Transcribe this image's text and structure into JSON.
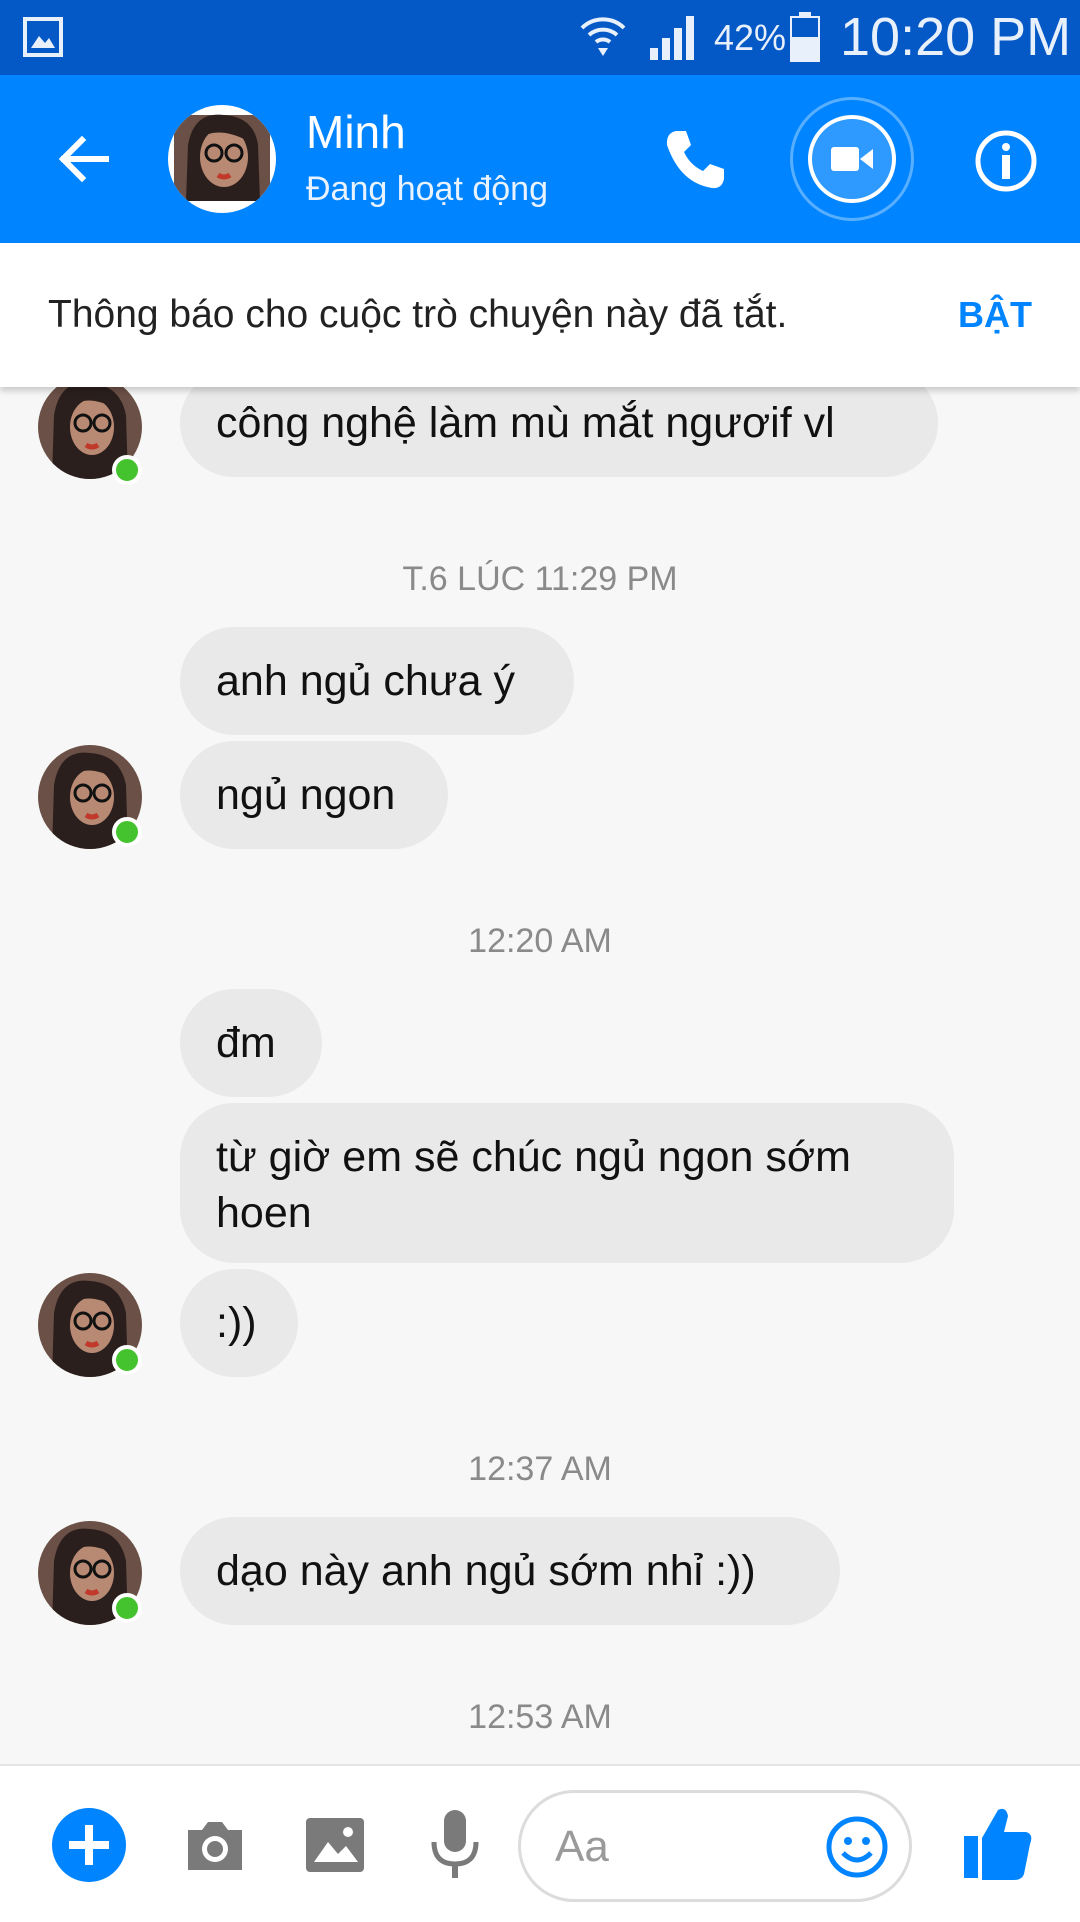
{
  "status_bar": {
    "battery_percent": "42%",
    "time": "10:20 PM"
  },
  "header": {
    "contact_name": "Minh",
    "contact_status": "Đang hoạt động"
  },
  "notice": {
    "text": "Thông báo cho cuộc trò chuyện này đã tắt.",
    "action_label": "BẬT"
  },
  "messages": [
    {
      "type": "bubble",
      "text": "công nghệ làm mù mắt ngươif vl"
    },
    {
      "type": "timestamp",
      "text": "T.6 LÚC 11:29 PM"
    },
    {
      "type": "bubble",
      "text": "anh ngủ chưa ý"
    },
    {
      "type": "bubble",
      "text": "ngủ ngon"
    },
    {
      "type": "timestamp",
      "text": "12:20 AM"
    },
    {
      "type": "bubble",
      "text": "đm"
    },
    {
      "type": "bubble",
      "text": "từ giờ em sẽ chúc ngủ ngon sớm hoen"
    },
    {
      "type": "bubble",
      "text": ":))"
    },
    {
      "type": "timestamp",
      "text": "12:37 AM"
    },
    {
      "type": "bubble",
      "text": "dạo này anh ngủ sớm nhỉ :))"
    },
    {
      "type": "timestamp",
      "text": "12:53 AM"
    }
  ],
  "composer": {
    "placeholder": "Aa"
  },
  "colors": {
    "brand": "#0084ff",
    "status_bar": "#0459c7",
    "online": "#44c32e",
    "bubble": "#e9e9e9"
  },
  "icons": [
    "gallery-icon",
    "wifi-icon",
    "signal-icon",
    "battery-icon",
    "back-arrow-icon",
    "phone-icon",
    "video-camera-icon",
    "info-icon",
    "plus-icon",
    "camera-icon",
    "image-icon",
    "microphone-icon",
    "emoji-icon",
    "thumbs-up-icon"
  ]
}
